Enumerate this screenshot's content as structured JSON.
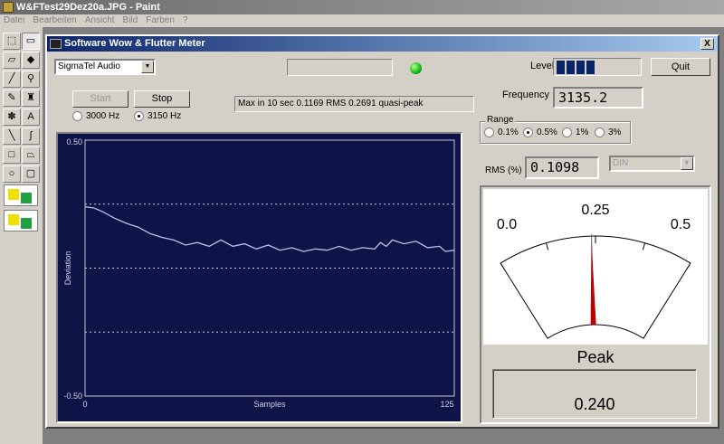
{
  "paint": {
    "title": "W&FTest29Dez20a.JPG - Paint",
    "menu": [
      "Datei",
      "Bearbeiten",
      "Ansicht",
      "Bild",
      "Farben",
      "?"
    ],
    "tools": [
      {
        "name": "free-select-icon",
        "glyph": "⬚"
      },
      {
        "name": "rect-select-icon",
        "glyph": "▭"
      },
      {
        "name": "eraser-icon",
        "glyph": "▱"
      },
      {
        "name": "fill-bucket-icon",
        "glyph": "◆"
      },
      {
        "name": "color-picker-icon",
        "glyph": "╱"
      },
      {
        "name": "magnifier-icon",
        "glyph": "⚲"
      },
      {
        "name": "pencil-icon",
        "glyph": "✎"
      },
      {
        "name": "brush-icon",
        "glyph": "♜"
      },
      {
        "name": "airbrush-icon",
        "glyph": "✽"
      },
      {
        "name": "text-icon",
        "glyph": "A"
      },
      {
        "name": "line-icon",
        "glyph": "╲"
      },
      {
        "name": "curve-icon",
        "glyph": "∫"
      },
      {
        "name": "rectangle-icon",
        "glyph": "□"
      },
      {
        "name": "polygon-icon",
        "glyph": "⏢"
      },
      {
        "name": "ellipse-icon",
        "glyph": "○"
      },
      {
        "name": "rounded-rect-icon",
        "glyph": "▢"
      }
    ]
  },
  "app": {
    "title": "Software Wow & Flutter Meter",
    "close_label": "X",
    "device": {
      "selected": "SigmaTel Audio"
    },
    "status_value": "",
    "level_label": "Level",
    "level_fraction": 0.45,
    "quit_label": "Quit",
    "start_label": "Start",
    "stop_label": "Stop",
    "freq_options": [
      {
        "label": "3000 Hz",
        "selected": false
      },
      {
        "label": "3150 Hz",
        "selected": true
      }
    ],
    "summary": "Max in 10 sec 0.1169 RMS 0.2691 quasi-peak",
    "frequency_label": "Frequency",
    "frequency_value": "3135.2",
    "range_label": "Range",
    "range_options": [
      {
        "label": "0.1%",
        "selected": false
      },
      {
        "label": "0.5%",
        "selected": true
      },
      {
        "label": "1%",
        "selected": false
      },
      {
        "label": "3%",
        "selected": false
      }
    ],
    "rms_label": "RMS (%)",
    "rms_value": "0.1098",
    "weighting": {
      "selected": "DIN"
    },
    "meter": {
      "left_label": "0.0",
      "center_label": "0.25",
      "right_label": "0.5",
      "min": 0.0,
      "max": 0.5,
      "peak_value": 0.24,
      "rms_value": 0.2395,
      "peak_title": "Peak",
      "peak_text": "0.240"
    },
    "colors": {
      "chart_bg": "#0e1448",
      "trace": "#b4c4e8",
      "needle": "#c00000",
      "accent": "#0a246a"
    }
  },
  "chart_data": {
    "type": "line",
    "title": "",
    "xlabel": "Samples",
    "ylabel": "Deviation",
    "xlim": [
      0,
      125
    ],
    "ylim": [
      -0.5,
      0.5
    ],
    "x_ticks": [
      "0",
      "125"
    ],
    "y_ticks": [
      "0.50",
      "-0.50"
    ],
    "grid": "dotted at 0.25, 0, -0.25",
    "series": [
      {
        "x": [
          0,
          3,
          6,
          10,
          14,
          18,
          22,
          26,
          30,
          34,
          38,
          42,
          46,
          50,
          54,
          58,
          62,
          66,
          70,
          74,
          78,
          82,
          86,
          90,
          94,
          98,
          100,
          102,
          104,
          108,
          112,
          116,
          120,
          122,
          125
        ],
        "values": [
          0.24,
          0.235,
          0.22,
          0.195,
          0.175,
          0.16,
          0.135,
          0.12,
          0.11,
          0.09,
          0.1,
          0.085,
          0.11,
          0.085,
          0.095,
          0.075,
          0.09,
          0.07,
          0.08,
          0.065,
          0.075,
          0.07,
          0.085,
          0.07,
          0.08,
          0.075,
          0.1,
          0.085,
          0.11,
          0.095,
          0.105,
          0.08,
          0.085,
          0.065,
          0.07
        ]
      }
    ]
  }
}
